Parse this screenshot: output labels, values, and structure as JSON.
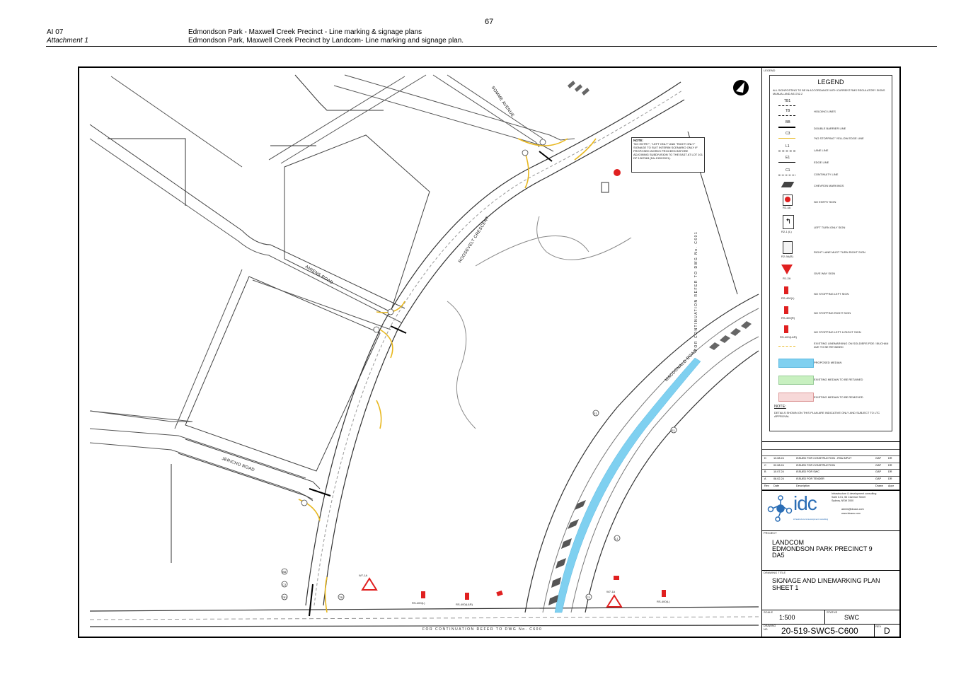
{
  "page_number": "67",
  "header": {
    "item": "AI 07",
    "attachment": "Attachment 1",
    "title_1": "Edmondson Park - Maxwell Creek Precinct - Line marking & signage plans",
    "title_2": "Edmondson Park, Maxwell Creek Precinct by Landcom- Line marking and signage plan."
  },
  "drawing": {
    "roads": {
      "somme": "SOMME AVENUE",
      "roosevelt": "ROOSEVELT CRESCENT",
      "amiens": "AMIENS ROAD",
      "jericho": "JERICHO ROAD",
      "macdonald": "MACDONALD ROAD"
    },
    "continuation_bottom": "FOR CONTINUATION REFER TO DWG No. C600",
    "continuation_right": "FOR CONTINUATION REFER TO DWG No. C601",
    "note_title": "NOTE:",
    "note_text": "\"NO ENTRY\", \"LEFT ONLY\" AND \"RIGHT ONLY\" SIGNAGE TO SUIT INTERIM SCENARIO ONLY IF PROPOSED WORKS PROCEED BEFORE ADJOINING SUBDIVISION TO THE EAST AT LOT 101 DP 1267563 (DA-1320/2021).",
    "sign_labels": {
      "rs_l": "RS-400(L)",
      "rs_lr": "RS-400(L&R)",
      "rs_r": "RS-400(R)",
      "r2_4a": "R2-4A",
      "r2_1": "R2-1 (L)",
      "giveway": "W7-1A"
    },
    "callouts": [
      "BB",
      "C3",
      "TB1",
      "TB",
      "E1",
      "L1",
      "C1"
    ]
  },
  "legend": {
    "small_title": "LEGEND",
    "title": "LEGEND",
    "intro": "ALL SIGNPOSTING TO BE IN ACCORDANCE WITH CURRENT RMS REGULATORY SIGNS MANUAL AND AS1742.2",
    "items": [
      {
        "code": "TB1",
        "label": ""
      },
      {
        "code": "TB",
        "label": "HOLDING LINES"
      },
      {
        "code": "BB",
        "label": "DOUBLE BARRIER LINE"
      },
      {
        "code": "C3",
        "label": "\"NO STOPPING\" YELLOW EDGE LINE"
      },
      {
        "code": "L1",
        "label": "LANE LINE"
      },
      {
        "code": "E1",
        "label": "EDGE LINE"
      },
      {
        "code": "C1",
        "label": "CONTINUITY LINE"
      },
      {
        "code": "",
        "label": "CHEVRON MARKINGS"
      },
      {
        "code": "R2-4A",
        "label": "NO ENTRY SIGN"
      },
      {
        "code": "R2-1 (L)",
        "label": "LEFT TURN ONLY SIGN"
      },
      {
        "code": "R2-9A(R)",
        "label": "RIGHT LANE MUST TURN RIGHT SIGN"
      },
      {
        "code": "R1-2A",
        "label": "GIVE WAY SIGN"
      },
      {
        "code": "RS-400(L)",
        "label": "NO STOPPING LEFT SIGN"
      },
      {
        "code": "RS-400(R)",
        "label": "NO STOPPING RIGHT SIGN"
      },
      {
        "code": "RS-400(L&R)",
        "label": "NO STOPPING LEFT & RIGHT SIGN"
      },
      {
        "code": "",
        "label": "EXISTING LINEMARKING ON SOLDIERS PDE / BUCHAN AVE TO BE RETAINED"
      },
      {
        "code": "",
        "label": "PROPOSED MEDIAN"
      },
      {
        "code": "",
        "label": "EXISTING MEDIAN TO BE RETAINED"
      },
      {
        "code": "",
        "label": "EXISTING MEDIAN TO BE REMOVED"
      }
    ],
    "note_title": "NOTE:",
    "note_text": "DETAILS SHOWN ON THIS PLAN ARE INDICATIVE ONLY AND SUBJECT TO LTC APPROVAL"
  },
  "revisions": {
    "headers": [
      "Rev",
      "Date",
      "Description",
      "Drawn",
      "Appr"
    ],
    "rows": [
      [
        "D",
        "13.08.24",
        "ISSUED FOR CONSTRUCTION - RSA INPUT",
        "GAP",
        "DR"
      ],
      [
        "C",
        "02.08.24",
        "ISSUED FOR CONSTRUCTION",
        "GAP",
        "DR"
      ],
      [
        "B",
        "10.07.24",
        "ISSUED FOR SWC",
        "GAP",
        "DR"
      ],
      [
        "A",
        "08.02.24",
        "ISSUED FOR TENDER",
        "GAP",
        "DR"
      ]
    ]
  },
  "company": {
    "logo_text": "idc",
    "tagline": "infrastructure & development consulting",
    "address_1": "Infrastructure & development consulting",
    "address_2": "Suite 6.01, 56 Clarence Street",
    "address_3": "Sydney, NSW 2000",
    "email": "admin@idcaus.com",
    "web": "www.idcaus.com"
  },
  "title_block": {
    "project_label": "PROJECT",
    "project_1": "LANDCOM",
    "project_2": "EDMONDSON PARK PRECINCT 9",
    "project_3": "DA5",
    "drawing_title_label": "DRAWING TITLE",
    "drawing_title_1": "SIGNAGE AND LINEMARKING PLAN",
    "drawing_title_2": "SHEET 1",
    "scale_label": "SCALE",
    "scale": "1:500",
    "status_label": "STATUS",
    "status": "SWC",
    "drawing_no_label": "DRAWING NO.",
    "drawing_no": "20-519-SWC5-C600",
    "rev_label": "REV",
    "rev": "D"
  },
  "colors": {
    "proposed_median": "#7fd0f0",
    "existing_median_retained": "#c8f0c0",
    "existing_median_removed": "#f7d8d8",
    "yellow_line": "#e8b820",
    "sign_red": "#e02020"
  }
}
